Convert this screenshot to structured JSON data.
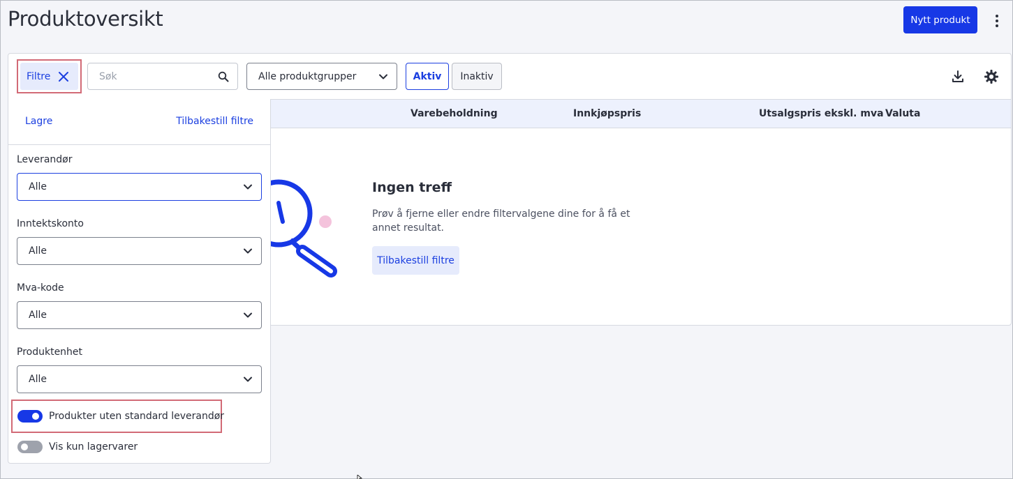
{
  "header": {
    "title": "Produktoversikt",
    "new_product_label": "Nytt produkt",
    "more_icon": "kebab-vertical-icon"
  },
  "toolbar": {
    "filter_label": "Filtre",
    "search_placeholder": "Søk",
    "product_group_value": "Alle produktgrupper",
    "status_tabs": [
      {
        "label": "Aktiv",
        "selected": true
      },
      {
        "label": "Inaktiv",
        "selected": false
      }
    ],
    "icons": [
      "download-icon",
      "gear-icon"
    ]
  },
  "table": {
    "columns": [
      "Varebeholdning",
      "Innkjøpspris",
      "Utsalgspris ekskl. mva",
      "Valuta"
    ]
  },
  "empty_state": {
    "title": "Ingen treff",
    "text": "Prøv å fjerne eller endre filtervalgene dine for å få et annet resultat.",
    "button_label": "Tilbakestill filtre"
  },
  "filter_panel": {
    "save_label": "Lagre",
    "reset_label": "Tilbakestill filtre",
    "fields": [
      {
        "label": "Leverandør",
        "value": "Alle"
      },
      {
        "label": "Inntektskonto",
        "value": "Alle"
      },
      {
        "label": "Mva-kode",
        "value": "Alle"
      },
      {
        "label": "Produktenhet",
        "value": "Alle"
      }
    ],
    "toggles": [
      {
        "label": "Produkter uten standard leverandør",
        "on": true
      },
      {
        "label": "Vis kun lagervarer",
        "on": false
      }
    ]
  },
  "colors": {
    "primary": "#1738e6",
    "link": "#1b3fe0",
    "highlight": "#d26a76",
    "header_bg": "#edf1fd"
  }
}
